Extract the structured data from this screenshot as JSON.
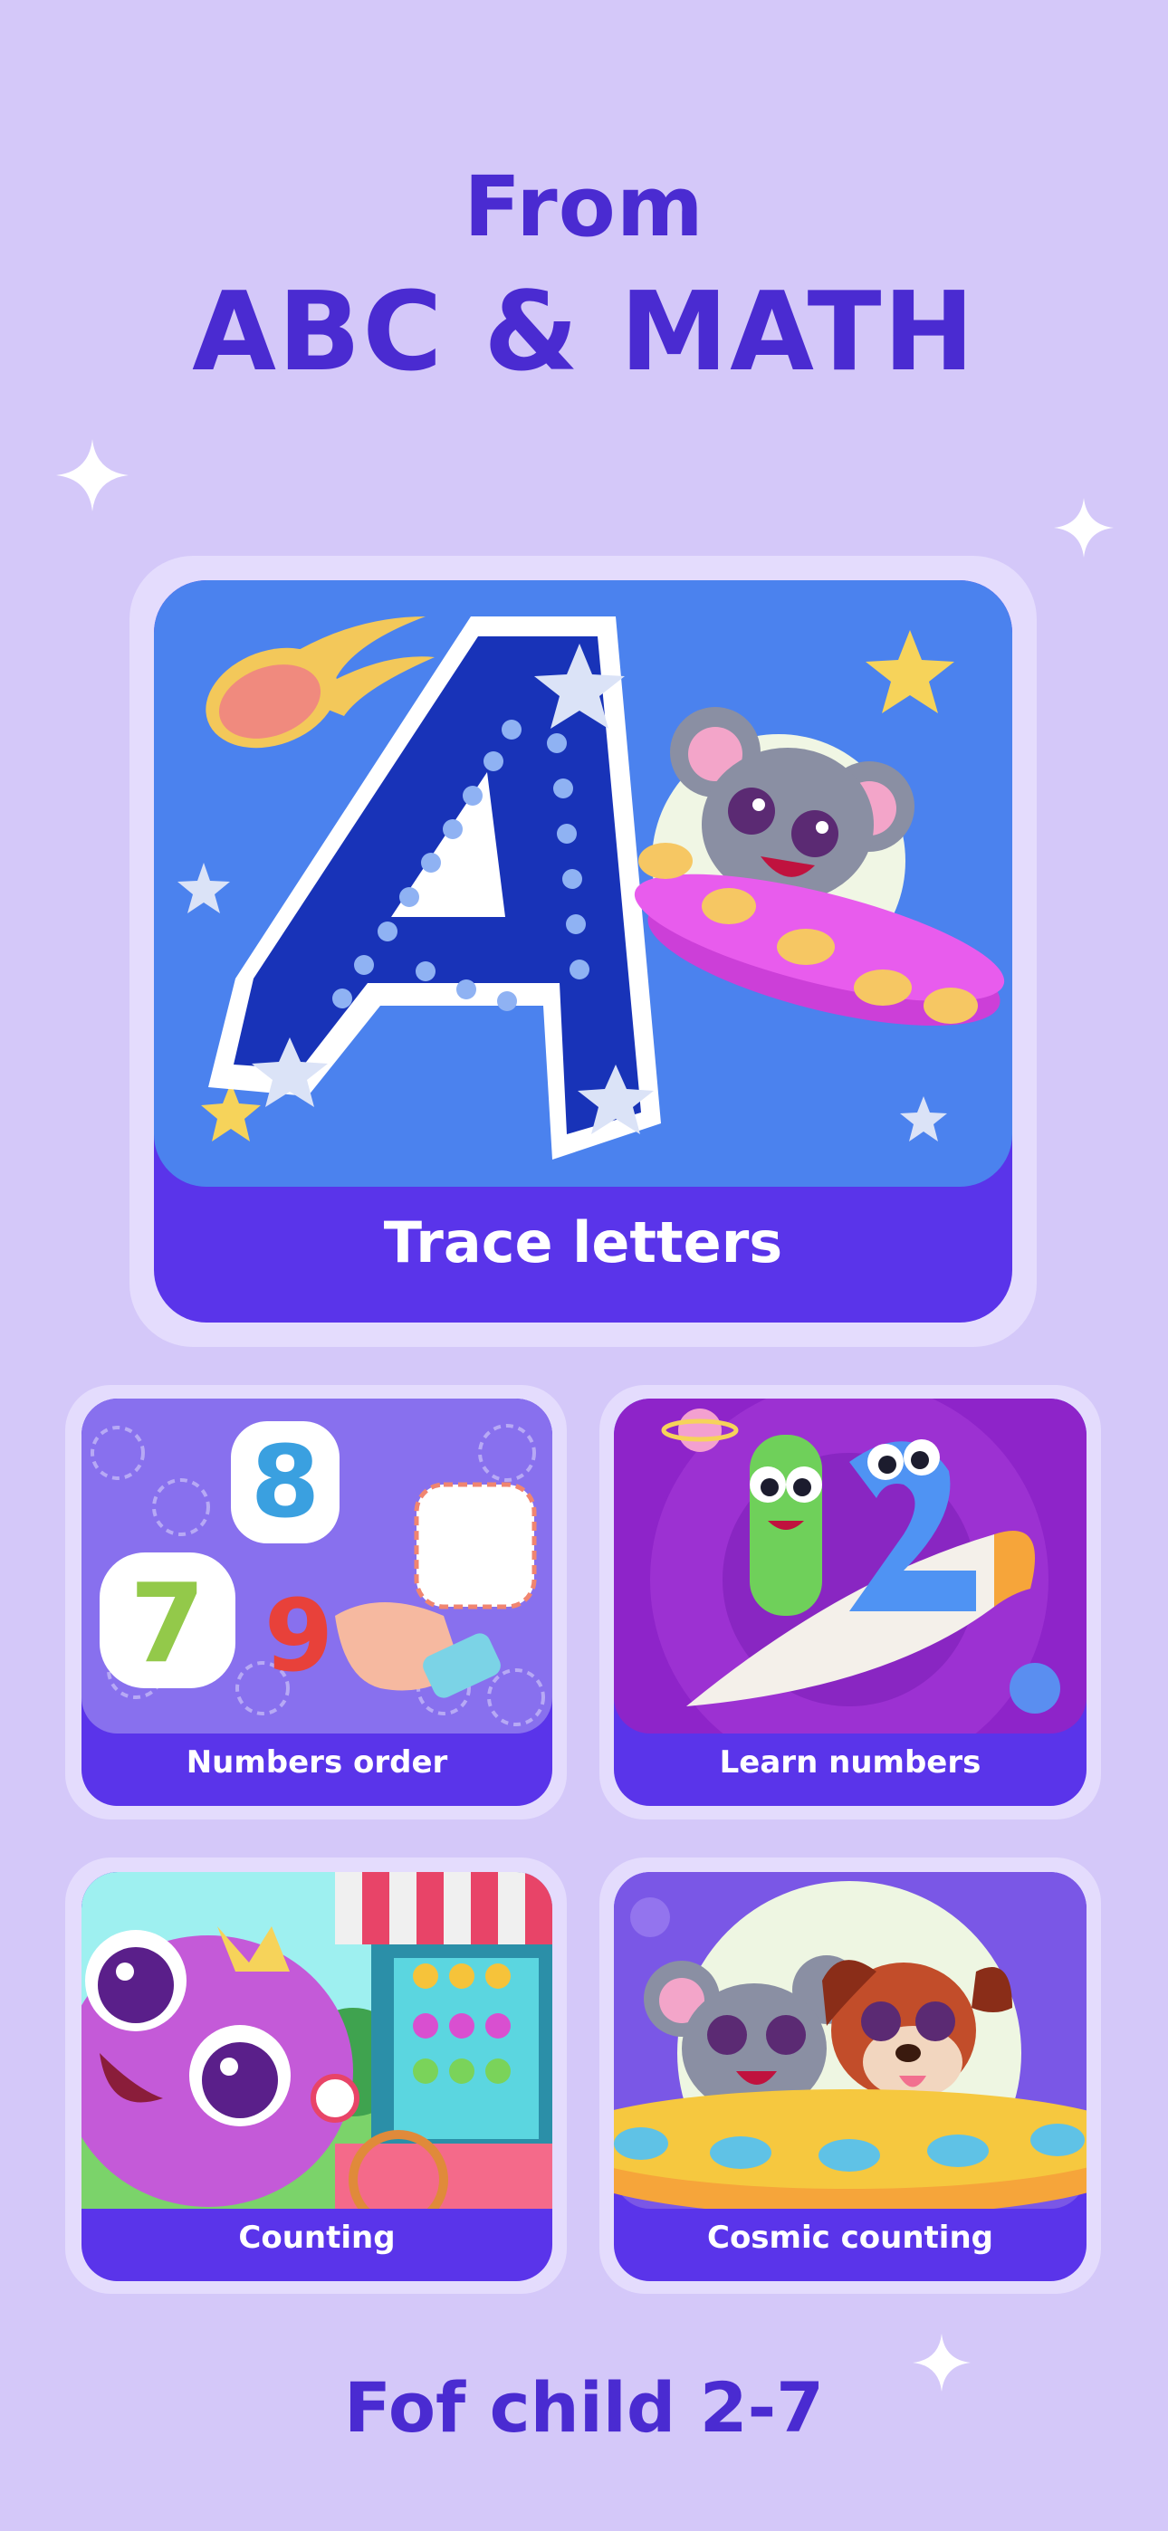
{
  "header": {
    "line1": "From",
    "line2": "ABC & MATH"
  },
  "cards": {
    "trace": {
      "label": "Trace letters"
    },
    "numbers_order": {
      "label": "Numbers order"
    },
    "learn_numbers": {
      "label": "Learn numbers"
    },
    "counting": {
      "label": "Counting"
    },
    "cosmic": {
      "label": "Cosmic counting"
    }
  },
  "footer": {
    "text": "Fof child 2-7"
  },
  "colors": {
    "background": "#d4c8f9",
    "brand": "#4a2bd1",
    "card_label_bg": "#5a34ea"
  }
}
